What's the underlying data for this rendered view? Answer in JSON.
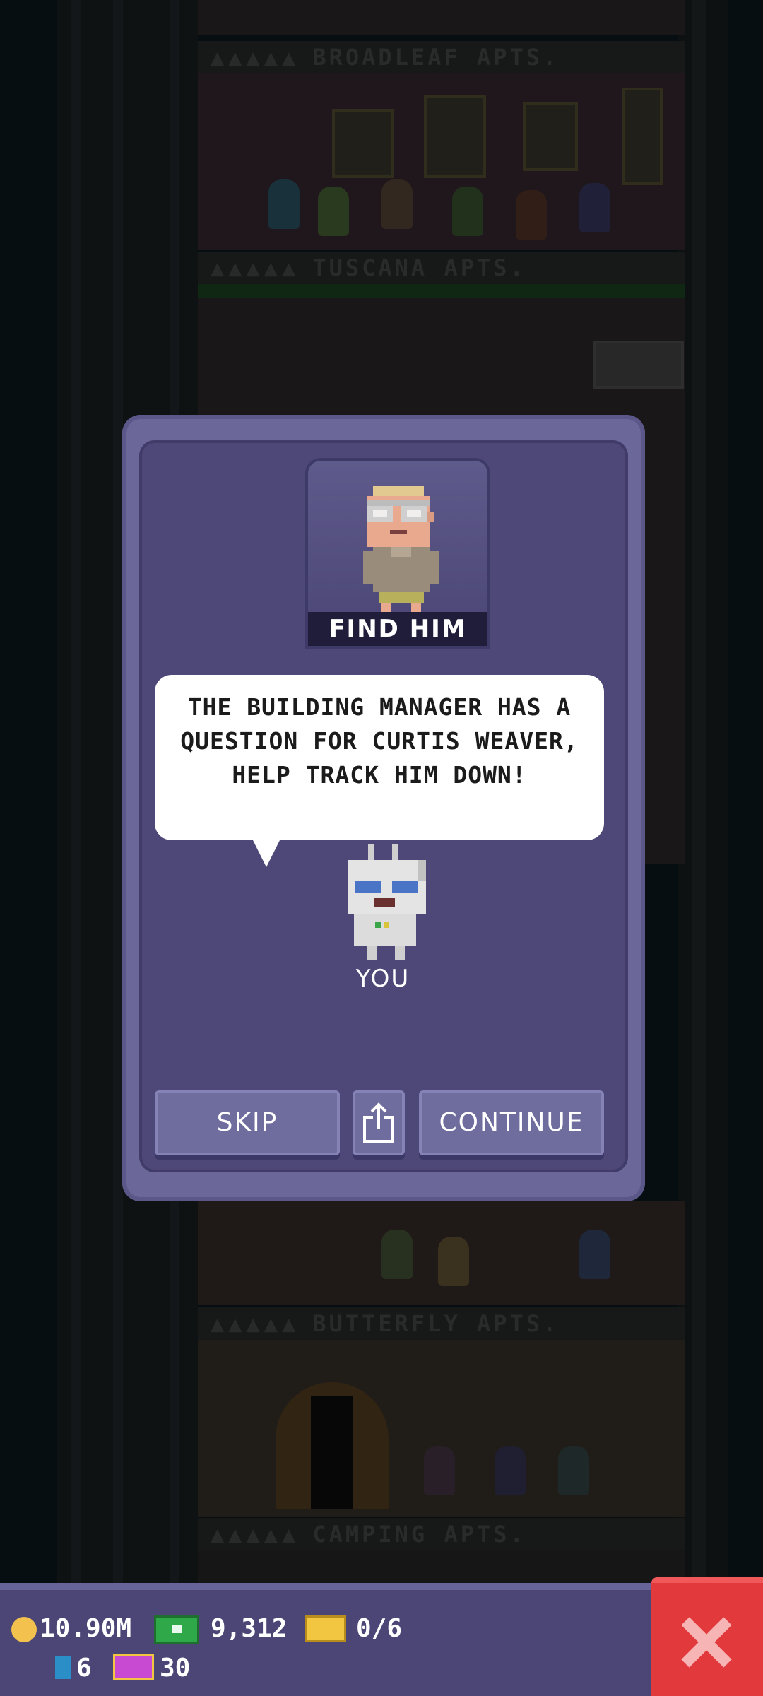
{
  "background": {
    "floors": [
      "BROADLEAF APTS.",
      "TUSCANA APTS.",
      "BUTTERFLY APTS.",
      "CAMPING APTS."
    ],
    "floor_sign_prefix": "▲▲▲▲▲"
  },
  "dialog": {
    "portrait_label": "FIND HIM",
    "message": "THE BUILDING MANAGER HAS A QUESTION FOR CURTIS WEAVER, HELP TRACK HIM DOWN!",
    "you_label": "YOU",
    "buttons": {
      "skip": "SKIP",
      "continue": "CONTINUE"
    }
  },
  "status_bar": {
    "coins": "10.90M",
    "bux": "9,312",
    "tickets": "0/6",
    "keys": "6",
    "vip": "30"
  },
  "colors": {
    "dialog_bg": "#4d4878",
    "dialog_border": "#6b6899",
    "close_button": "#e2393c",
    "coin": "#f2c14e",
    "bux": "#2fa84a",
    "ticket": "#f3c641"
  }
}
